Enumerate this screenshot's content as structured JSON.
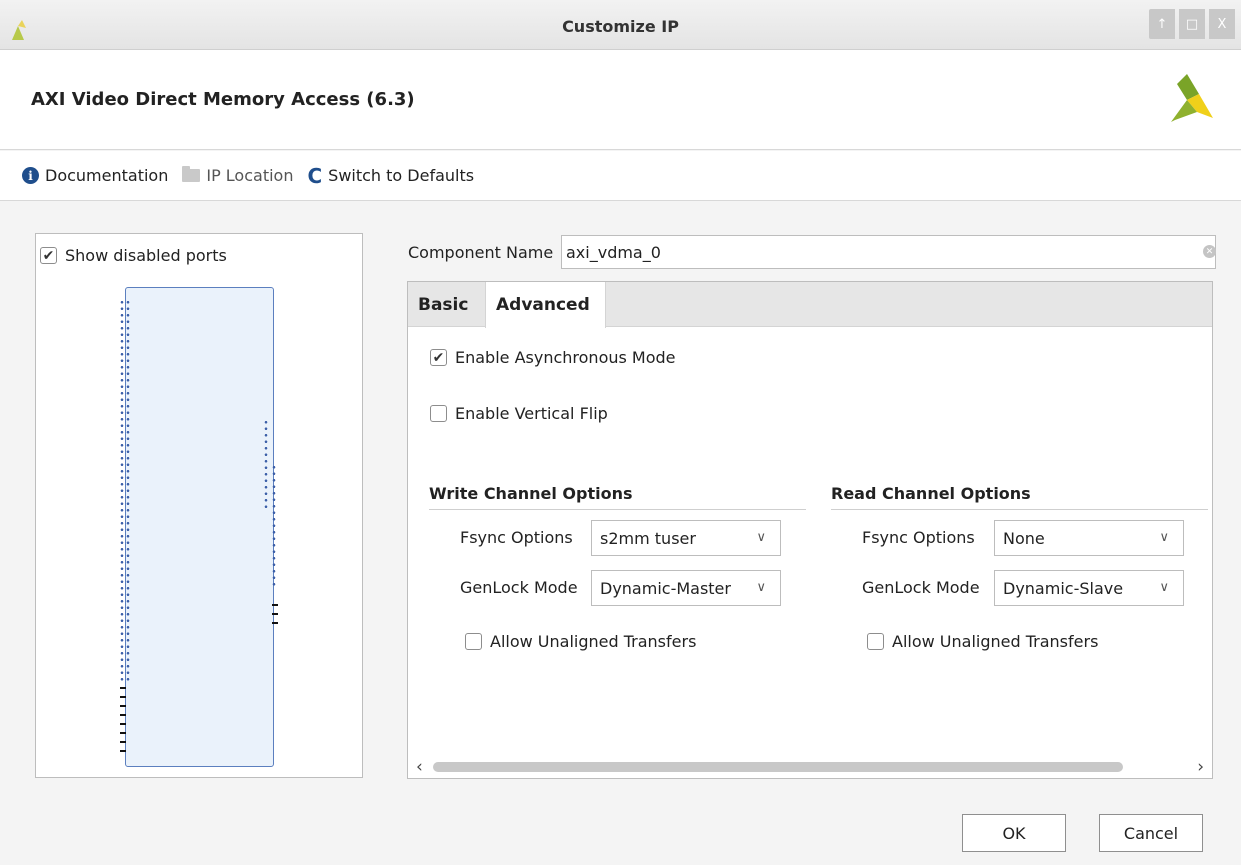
{
  "window": {
    "title": "Customize IP",
    "controls": [
      "↑",
      "□",
      "X"
    ]
  },
  "header": {
    "ip_name": "AXI Video Direct Memory Access (6.3)"
  },
  "toolbar": {
    "documentation": "Documentation",
    "ip_location": "IP Location",
    "switch_defaults": "Switch to Defaults"
  },
  "left_panel": {
    "show_disabled_ports_label": "Show disabled ports",
    "show_disabled_ports_checked": true
  },
  "component": {
    "label": "Component Name",
    "value": "axi_vdma_0"
  },
  "tabs": [
    {
      "label": "Basic",
      "active": false
    },
    {
      "label": "Advanced",
      "active": true
    }
  ],
  "advanced": {
    "async_mode_label": "Enable Asynchronous Mode",
    "async_mode_checked": true,
    "vertical_flip_label": "Enable Vertical Flip",
    "vertical_flip_checked": false,
    "write_channel": {
      "title": "Write Channel Options",
      "fsync_label": "Fsync Options",
      "fsync_value": "s2mm tuser",
      "genlock_label": "GenLock Mode",
      "genlock_value": "Dynamic-Master",
      "unaligned_label": "Allow Unaligned Transfers",
      "unaligned_checked": false
    },
    "read_channel": {
      "title": "Read Channel Options",
      "fsync_label": "Fsync Options",
      "fsync_value": "None",
      "genlock_label": "GenLock Mode",
      "genlock_value": "Dynamic-Slave",
      "unaligned_label": "Allow Unaligned Transfers",
      "unaligned_checked": false
    }
  },
  "buttons": {
    "ok": "OK",
    "cancel": "Cancel"
  },
  "glyphs": {
    "check": "✔",
    "chevron_down": "∨",
    "scroll_left": "‹",
    "scroll_right": "›",
    "clear": "✕"
  },
  "colors": {
    "accent_blue": "#1f4e8c",
    "logo_yellow": "#f0d01a",
    "logo_green": "#7aa428",
    "symbol_fill": "#eaf2fb",
    "symbol_border": "#5b7fbf"
  }
}
